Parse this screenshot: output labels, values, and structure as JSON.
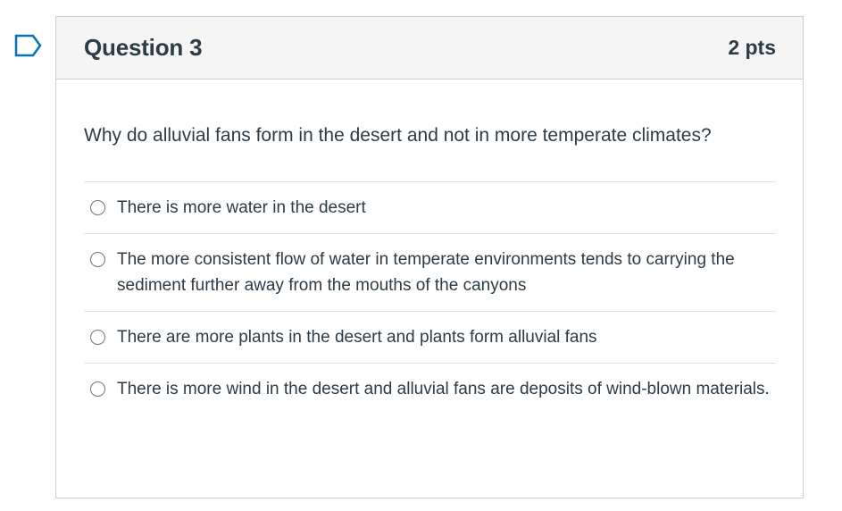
{
  "question": {
    "title": "Question 3",
    "points": "2 pts",
    "text": "Why do alluvial fans form in the desert and not in more temperate climates?",
    "answers": [
      {
        "label": "There is more water in the desert"
      },
      {
        "label": "The more consistent flow of water in temperate environments tends to carrying the sediment further away from the mouths of the canyons"
      },
      {
        "label": "There are more plants in the desert and plants form alluvial fans"
      },
      {
        "label": "There is more wind in the desert and alluvial fans are deposits of wind-blown materials."
      }
    ]
  },
  "icons": {
    "flag": "flag-question-icon",
    "radio": "radio-button-icon"
  },
  "colors": {
    "text": "#2d3b45",
    "header_bg": "#f5f5f5",
    "border": "#c7cdd1",
    "flag_accent": "#0374b5"
  }
}
